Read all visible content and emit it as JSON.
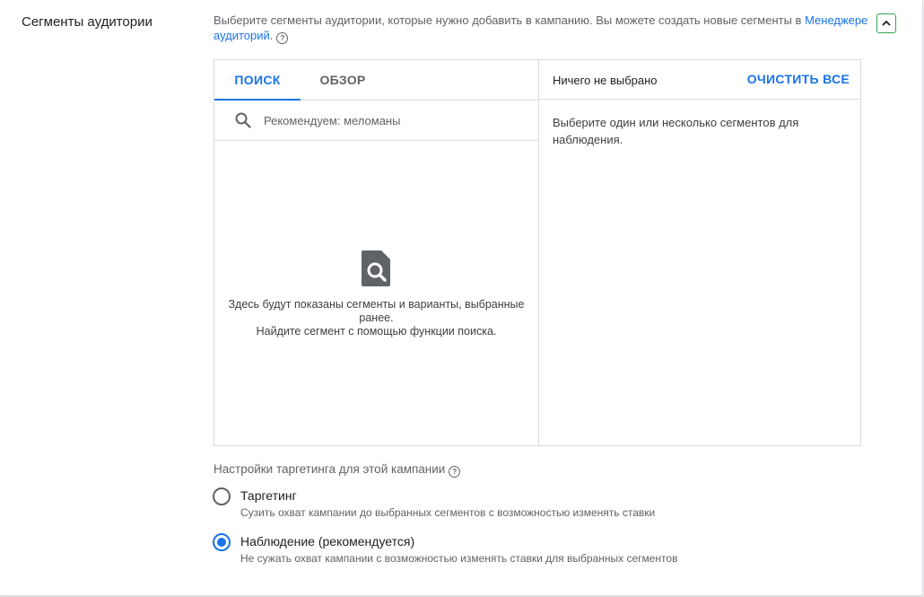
{
  "section": {
    "label": "Сегменты аудитории",
    "description_prefix": "Выберите сегменты аудитории, которые нужно добавить в кампанию. Вы можете создать новые сегменты в ",
    "description_link": "Менеджере аудиторий",
    "description_suffix": ".",
    "help_glyph": "?",
    "collapse_icon": "chevron-up-icon"
  },
  "tabs": [
    {
      "label": "ПОИСК",
      "active": true
    },
    {
      "label": "ОБЗОР",
      "active": false
    }
  ],
  "search": {
    "placeholder": "Рекомендуем: меломаны",
    "value": ""
  },
  "empty_state": {
    "icon": "find-in-page-icon",
    "line1": "Здесь будут показаны сегменты и варианты, выбранные ранее.",
    "line2": "Найдите сегмент с помощью функции поиска."
  },
  "selection": {
    "label": "Ничего не выбрано",
    "clear_all": "ОЧИСТИТЬ ВСЕ",
    "hint": "Выберите один или несколько сегментов для наблюдения."
  },
  "targeting": {
    "title": "Настройки таргетинга для этой кампании",
    "help_glyph": "?",
    "options": [
      {
        "label": "Таргетинг",
        "description": "Сузить охват кампании до выбранных сегментов с возможностью изменять ставки",
        "selected": false
      },
      {
        "label": "Наблюдение (рекомендуется)",
        "description": "Не сужать охват кампании с возможностью изменять ставки для выбранных сегментов",
        "selected": true
      }
    ]
  },
  "colors": {
    "accent": "#1a73e8",
    "focus_border": "#34a853",
    "divider": "#dadce0"
  }
}
